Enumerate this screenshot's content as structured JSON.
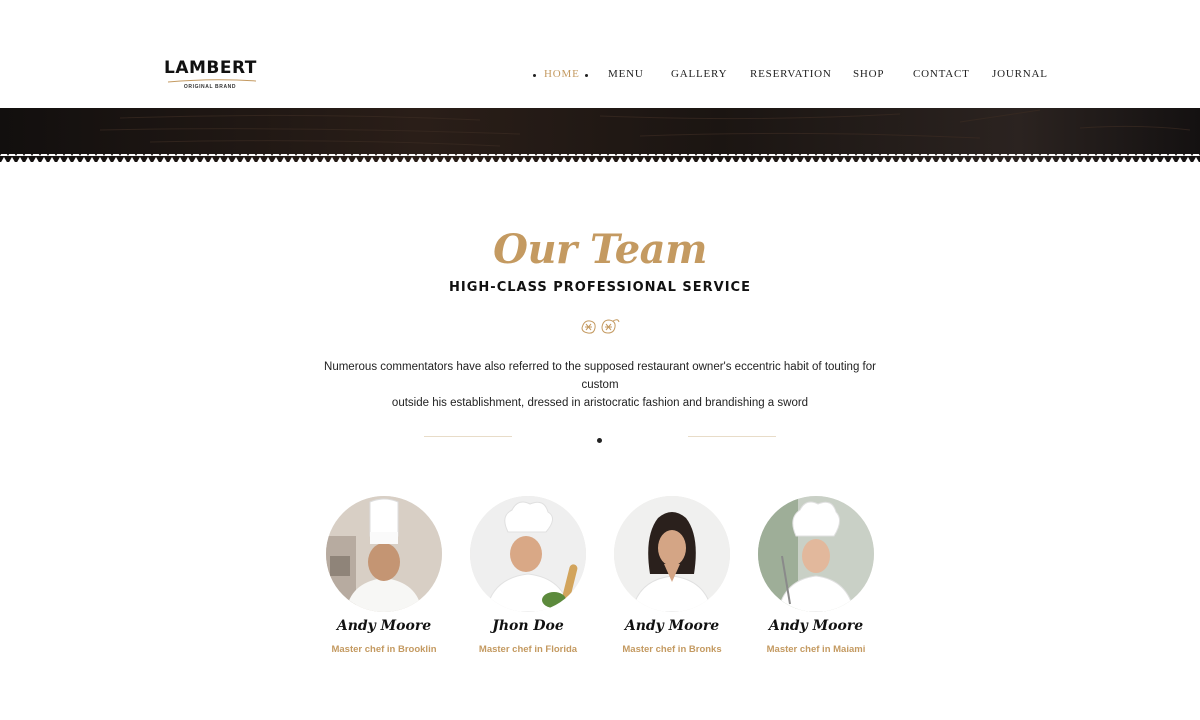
{
  "brand": {
    "name": "LAMBERT",
    "tagline": "ORIGINAL BRAND"
  },
  "nav": {
    "items": [
      {
        "label": "HOME",
        "active": true
      },
      {
        "label": "MENU",
        "active": false
      },
      {
        "label": "GALLERY",
        "active": false
      },
      {
        "label": "RESERVATION",
        "active": false
      },
      {
        "label": "SHOP",
        "active": false
      },
      {
        "label": "CONTACT",
        "active": false
      },
      {
        "label": "JOURNAL",
        "active": false
      }
    ]
  },
  "team_section": {
    "title": "Our Team",
    "subtitle": "HIGH-CLASS PROFESSIONAL SERVICE",
    "description_line1": "Numerous commentators have also referred to the supposed restaurant owner's eccentric habit of touting for custom",
    "description_line2": "outside his establishment, dressed in aristocratic fashion and brandishing a sword",
    "members": [
      {
        "name": "Andy Moore",
        "role": "Master chef in Brooklin"
      },
      {
        "name": "Jhon Doe",
        "role": "Master chef in Florida"
      },
      {
        "name": "Andy Moore",
        "role": "Master chef in Bronks"
      },
      {
        "name": "Andy Moore",
        "role": "Master chef in Maiami"
      }
    ]
  },
  "colors": {
    "accent": "#c49a61",
    "text": "#222222",
    "banner": "#1a1412"
  },
  "icons": [
    "hop-ornament-icon"
  ]
}
